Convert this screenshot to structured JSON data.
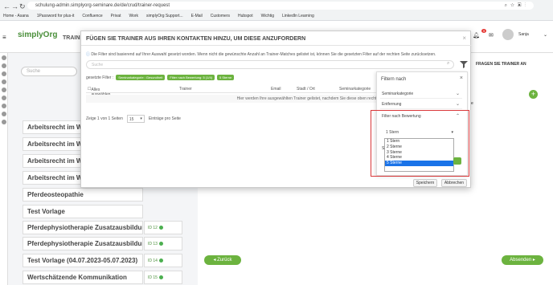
{
  "browser": {
    "url": "schulung-admin.simplyorg-seminare.de/de/crud/trainer-request",
    "bookmarks": [
      "Home - Asana",
      "1Password for plus-it",
      "Confluence",
      "Privat",
      "Work",
      "simplyOrg Support...",
      "E-Mail",
      "Customers",
      "Hubspot",
      "Wichtig",
      "LinkedIn Learning"
    ]
  },
  "app": {
    "logo_text": "simplyOrg",
    "header_partial": "TRAINE",
    "user_name": "Sanja",
    "notification_count": "9",
    "search_placeholder": "Suche",
    "list_items": [
      {
        "title": "Arbeitsrecht im Wa",
        "id": ""
      },
      {
        "title": "Arbeitsrecht im Wa",
        "id": ""
      },
      {
        "title": "Arbeitsrecht im Wa",
        "id": ""
      },
      {
        "title": "Arbeitsrecht im Wa",
        "id": ""
      },
      {
        "title": "Pferdeosteopathie",
        "id": ""
      },
      {
        "title": "Test Vorlage",
        "id": ""
      },
      {
        "title": "Pferdephysiotherapie Zusatzausbildun...",
        "id": "ID 12"
      },
      {
        "title": "Pferdephysiotherapie Zusatzausbildung",
        "id": "ID 13"
      },
      {
        "title": "Test Vorlage (04.07.2023-05.07.2023)",
        "id": "ID 14"
      },
      {
        "title": "Wertschätzende Kommunikation",
        "id": "ID 15"
      }
    ],
    "right_header": "FRAGEN SIE TRAINER AN",
    "right_subheader": "rte",
    "back_button": "Zurück",
    "send_button": "Absenden"
  },
  "modal": {
    "title": "FÜGEN SIE TRAINER AUS IHREN KONTAKTEN HINZU, UM DIESE ANZUFORDERN",
    "info": "Die Filter sind basierend auf Ihrer Auswahl gesetzt worden. Wenn nicht die gewünschte Anzahl an Trainer-Matches gelistet ist, können Sie die gesetzten Filter auf der rechten Seite zurücksetzen.",
    "search_placeholder": "Suche",
    "filters_label": "gesetzte Filter :",
    "filter_tags": [
      "Seminarkategorie : Gesundheit",
      "Filter nach Bewertung: 5 (1/4)",
      "5 Sterne"
    ],
    "columns": {
      "select_all": "Alles auswählen",
      "trainer": "Trainer",
      "email": "Email",
      "location": "Stadt / Ort",
      "category": "Seminarkategorie"
    },
    "empty_text": "Hier werden Ihre ausgewählten Trainer gelistet, nachdem Sie diese oben rechts über das \"Plus\" Icon hinzugefügt habe",
    "pager_text": "Zeige 1 von 1 Seiten",
    "per_page_value": "15",
    "per_page_label": "Einträge pro Seite",
    "save_button": "Speichern",
    "cancel_button": "Abbrechen"
  },
  "filter_panel": {
    "title": "Filtern nach",
    "sections": [
      "Seminarkategorie",
      "Entfernung",
      "Filter nach Bewertung"
    ],
    "rating_selected": "1 Stern",
    "rating_options": [
      "1 Stern",
      "2 Sterne",
      "3 Sterne",
      "4 Sterne",
      "5 Sterne"
    ],
    "rating_highlighted_index": 4,
    "partial_label": "Sc"
  }
}
